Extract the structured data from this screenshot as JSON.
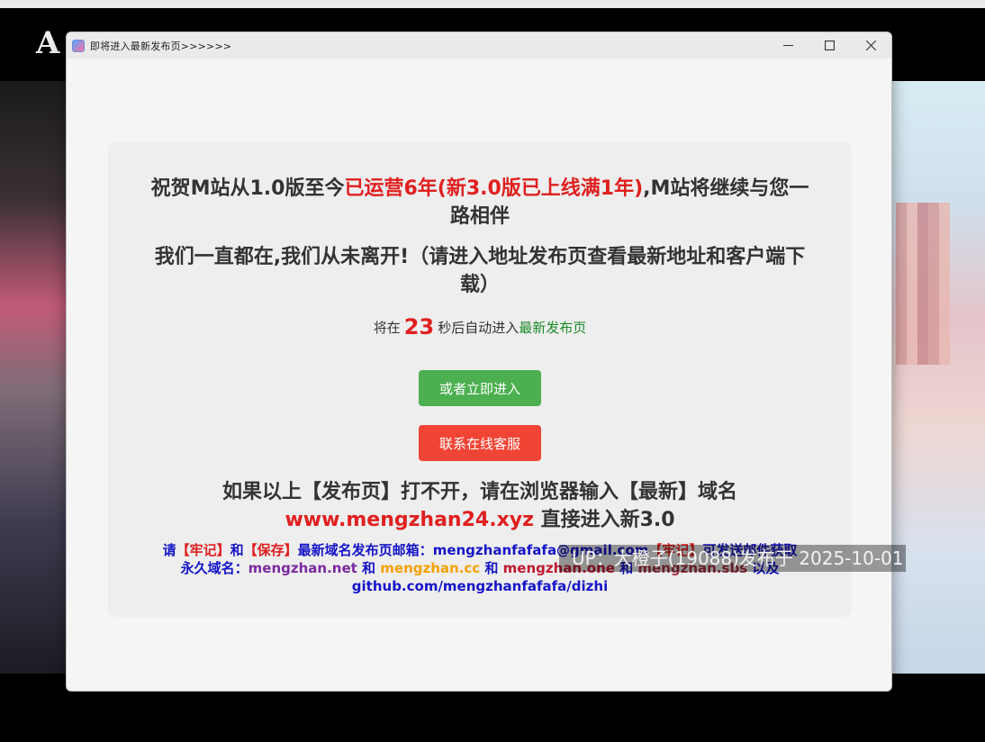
{
  "background": {
    "logo_text": "A"
  },
  "window": {
    "title": "即将进入最新发布页>>>>>>",
    "controls": [
      "minimize",
      "maximize",
      "close"
    ]
  },
  "card": {
    "headline_part1": "祝贺M站从1.0版至今",
    "headline_red": "已运营6年(新3.0版已上线满1年)",
    "headline_part2": ",M站将继续与您一路相伴",
    "headline2": "我们一直都在,我们从未离开!（请进入地址发布页查看最新地址和客户端下载）",
    "countdown_prefix": "将在",
    "countdown_seconds": "23",
    "countdown_middle": "秒后自动进入",
    "countdown_link": "最新发布页",
    "enter_button": "或者立即进入",
    "support_button": "联系在线客服",
    "fallback_line": "如果以上【发布页】打不开，请在浏览器输入【最新】域名",
    "fallback_domain": "www.mengzhan24.xyz",
    "fallback_suffix": " 直接进入新3.0",
    "notes": {
      "please": "请",
      "remember": "【牢记】",
      "and1": "和",
      "save": "【保存】",
      "email_label": "最新域名发布页邮箱：",
      "email": "mengzhanfafafa@gmail.com",
      "remember2": "【牢记】",
      "send_info": "可发送邮件获取",
      "perm_label": "永久域名：",
      "d1": "mengzhan.net",
      "and2": " 和 ",
      "d2": "mengzhan.cc",
      "and3": " 和 ",
      "d3": "mengzhan.one",
      "and4": " 和 ",
      "d4": "mengzhan.sbs",
      "yiji": " 以及",
      "github": "github.com/mengzhanfafafa/dizhi"
    }
  },
  "watermark": "UP：大橙子(19088)发布于 2025-10-01"
}
